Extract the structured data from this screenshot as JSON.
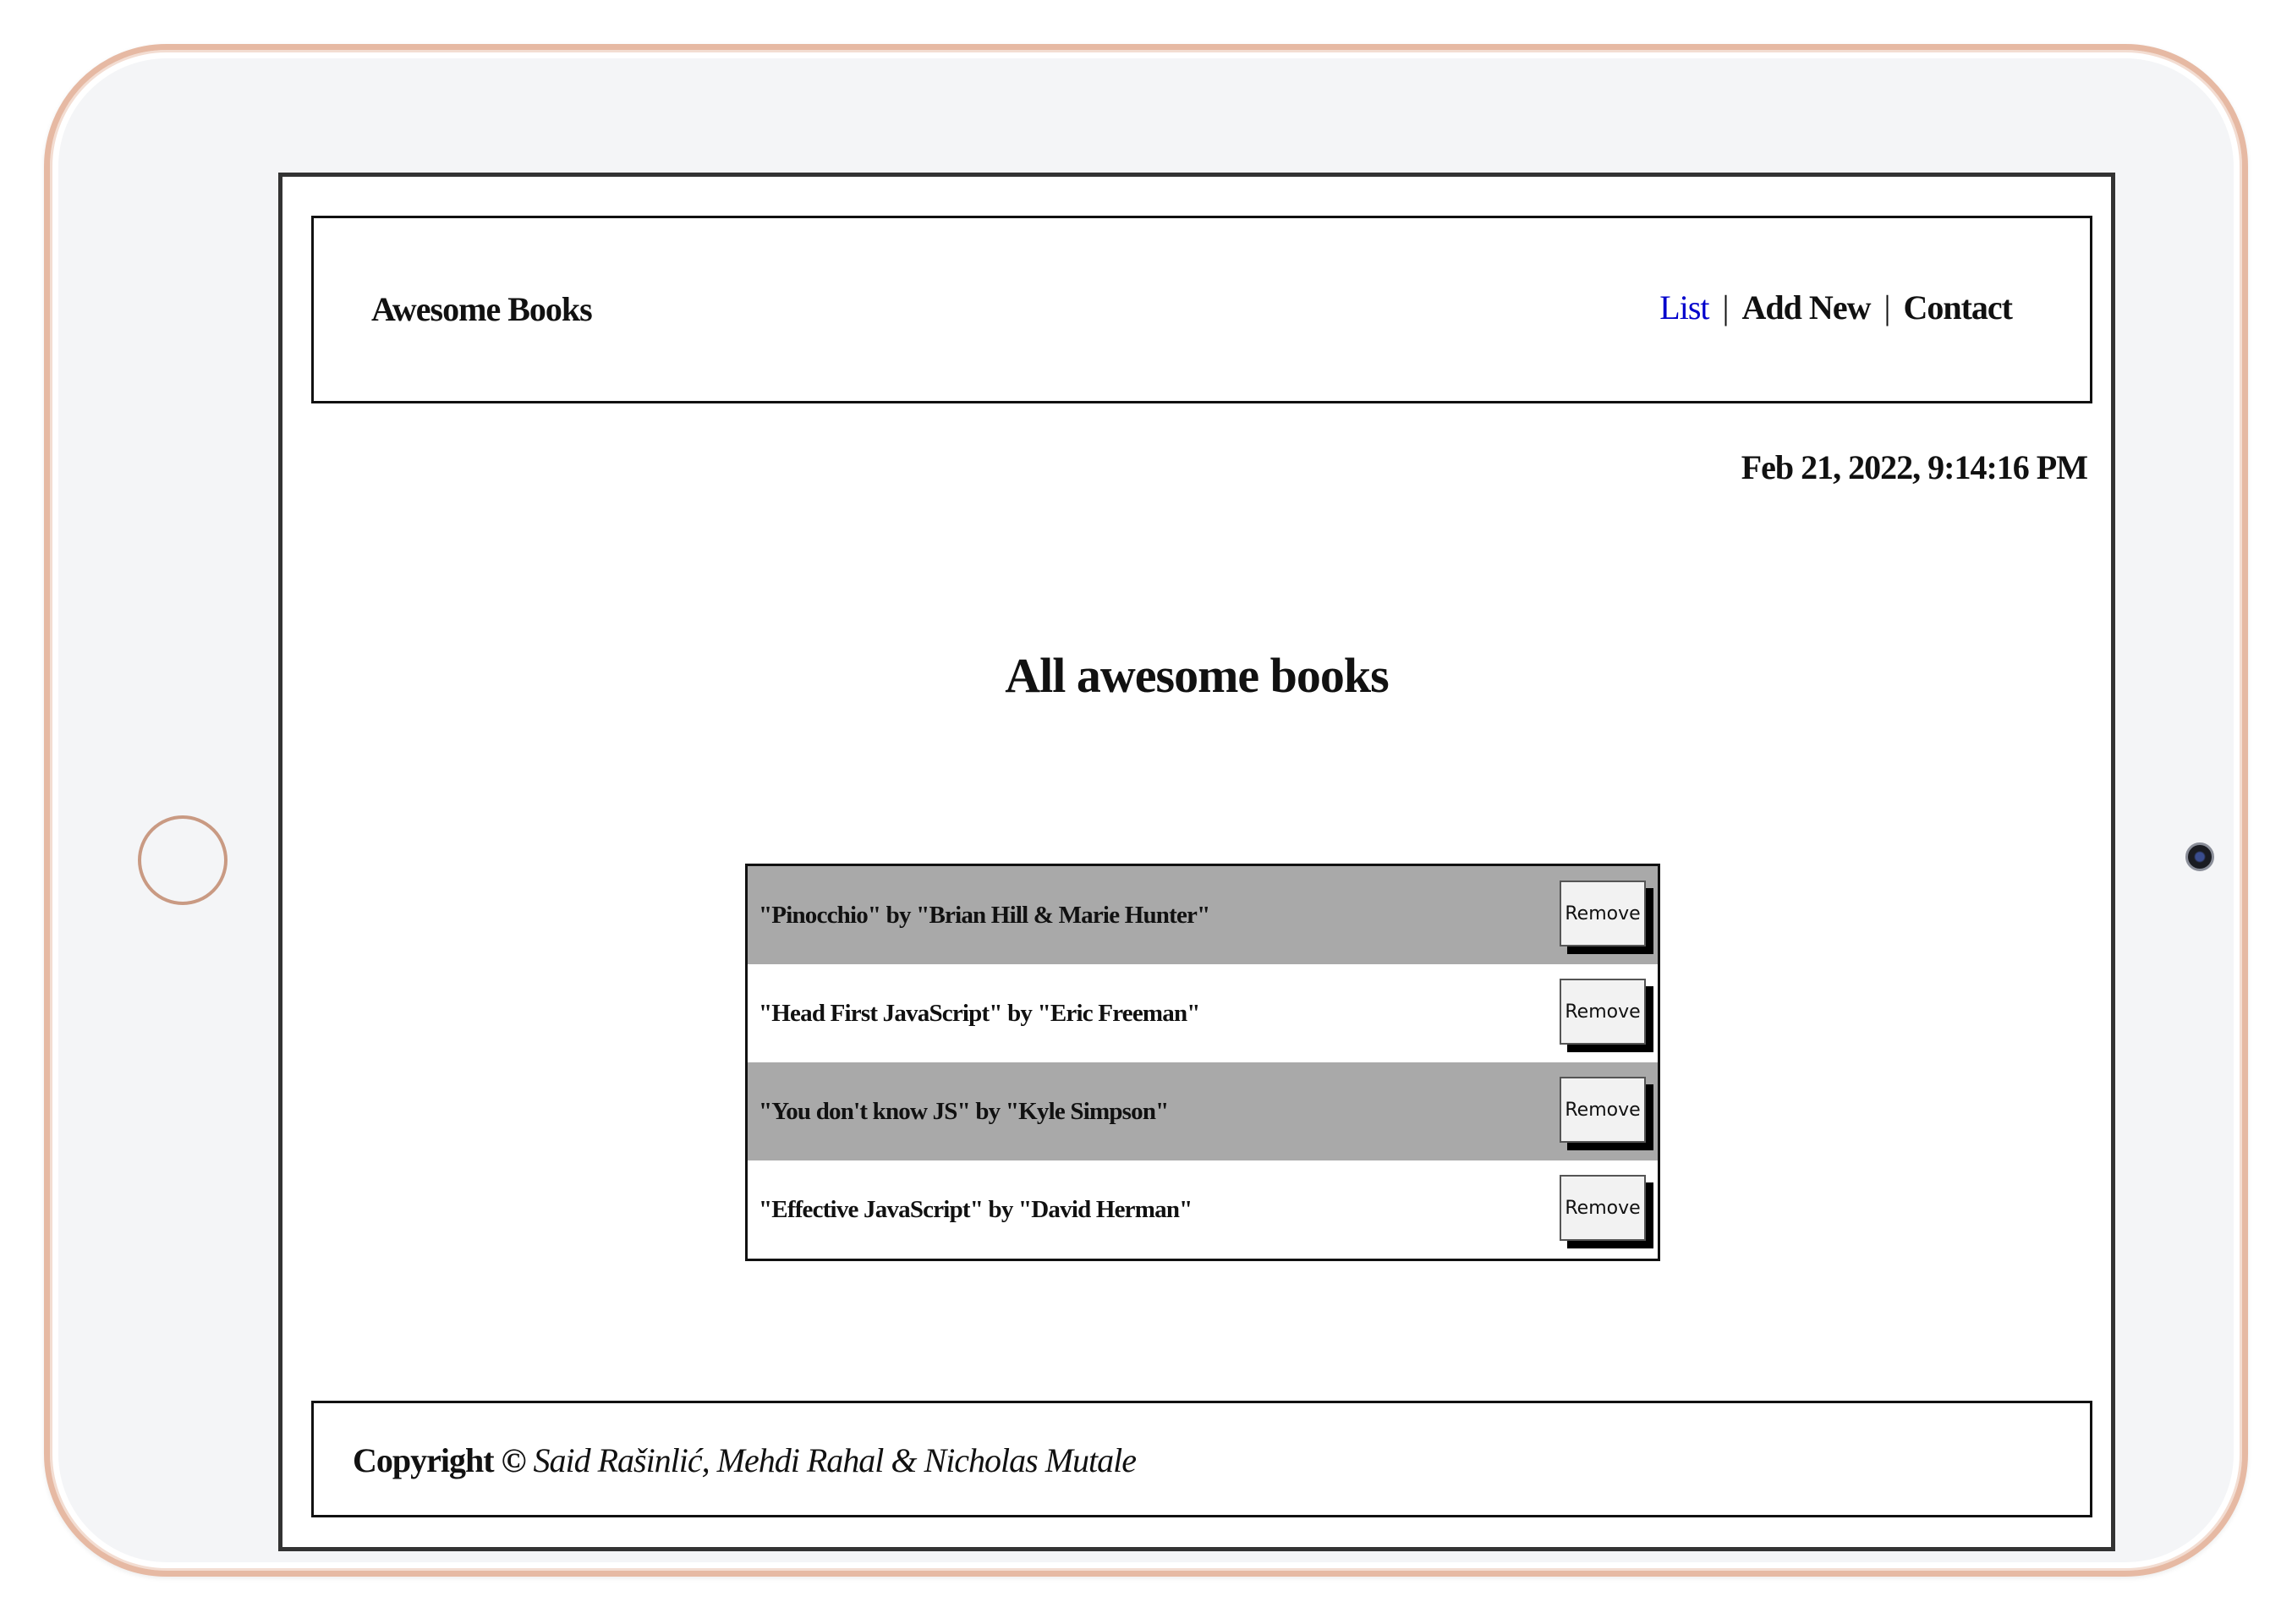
{
  "header": {
    "brand": "Awesome Books",
    "nav": [
      {
        "label": "List",
        "active": true
      },
      {
        "label": "Add New",
        "active": false
      },
      {
        "label": "Contact",
        "active": false
      }
    ],
    "separator": "|"
  },
  "datetime": "Feb 21, 2022, 9:14:16 PM",
  "main": {
    "title": "All awesome books",
    "books": [
      {
        "text": "\"Pinocchio\" by \"Brian Hill & Marie Hunter\"",
        "button": "Remove"
      },
      {
        "text": "\"Head First JavaScript\" by \"Eric Freeman\"",
        "button": "Remove"
      },
      {
        "text": "\"You don't know JS\" by \"Kyle Simpson\"",
        "button": "Remove"
      },
      {
        "text": "\"Effective JavaScript\" by \"David Herman\"",
        "button": "Remove"
      }
    ]
  },
  "footer": {
    "prefix": "Copyright ©",
    "authors": "Said Rašinlić, Mehdi Rahal & Nicholas Mutale"
  },
  "colors": {
    "active_link": "#0000cc",
    "odd_row": "#a9a9a9",
    "even_row": "#ffffff",
    "tablet_frame": "#e6b9a3"
  }
}
